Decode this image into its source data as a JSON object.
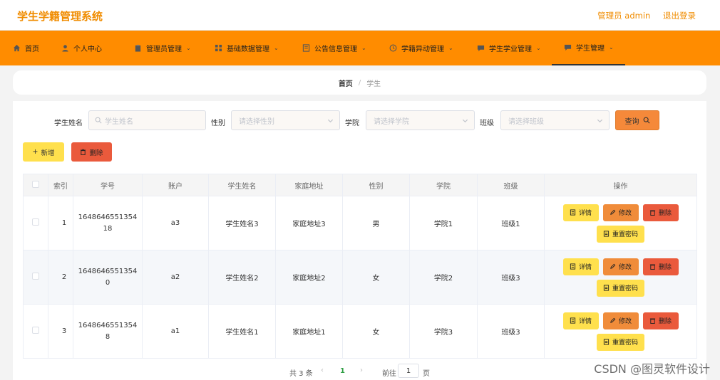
{
  "app": {
    "title": "学生学籍管理系统"
  },
  "header": {
    "user_label": "管理员 admin",
    "logout_label": "退出登录"
  },
  "nav": {
    "items": [
      {
        "label": "首页",
        "icon": "home-icon"
      },
      {
        "label": "个人中心",
        "icon": "user-icon"
      },
      {
        "label": "管理员管理",
        "icon": "clipboard-icon"
      },
      {
        "label": "基础数据管理",
        "icon": "grid-icon"
      },
      {
        "label": "公告信息管理",
        "icon": "document-icon"
      },
      {
        "label": "学籍异动管理",
        "icon": "clock-icon"
      },
      {
        "label": "学生学业管理",
        "icon": "chat-icon"
      },
      {
        "label": "学生管理",
        "icon": "chat-icon"
      }
    ],
    "active_index": 7
  },
  "breadcrumb": {
    "home": "首页",
    "current": "学生"
  },
  "search": {
    "name_label": "学生姓名",
    "name_placeholder": "学生姓名",
    "gender_label": "性别",
    "gender_placeholder": "请选择性别",
    "college_label": "学院",
    "college_placeholder": "请选择学院",
    "class_label": "班级",
    "class_placeholder": "请选择班级",
    "query_label": "查询"
  },
  "actions": {
    "add_label": "新增",
    "delete_label": "删除"
  },
  "table": {
    "headers": [
      "索引",
      "学号",
      "账户",
      "学生姓名",
      "家庭地址",
      "性别",
      "学院",
      "班级",
      "操作"
    ],
    "rows": [
      {
        "index": "1",
        "student_no": "164864655135418",
        "account": "a3",
        "name": "学生姓名3",
        "address": "家庭地址3",
        "gender": "男",
        "college": "学院1",
        "class": "班级1"
      },
      {
        "index": "2",
        "student_no": "16486465513540",
        "account": "a2",
        "name": "学生姓名2",
        "address": "家庭地址2",
        "gender": "女",
        "college": "学院2",
        "class": "班级3"
      },
      {
        "index": "3",
        "student_no": "16486465513548",
        "account": "a1",
        "name": "学生姓名1",
        "address": "家庭地址1",
        "gender": "女",
        "college": "学院3",
        "class": "班级3"
      }
    ],
    "row_actions": {
      "detail": "详情",
      "edit": "修改",
      "delete": "删除",
      "reset_password": "重置密码"
    }
  },
  "pagination": {
    "total_text": "共 3 条",
    "current_page": "1",
    "goto_label": "前往",
    "goto_value": "1",
    "page_suffix": "页"
  },
  "watermark": "CSDN @图灵软件设计",
  "colors": {
    "accent": "#ff8c00",
    "title": "#f08c00",
    "yellow_button": "#ffe04d",
    "red_button": "#ea5a3c",
    "orange_button": "#f08c3a"
  }
}
